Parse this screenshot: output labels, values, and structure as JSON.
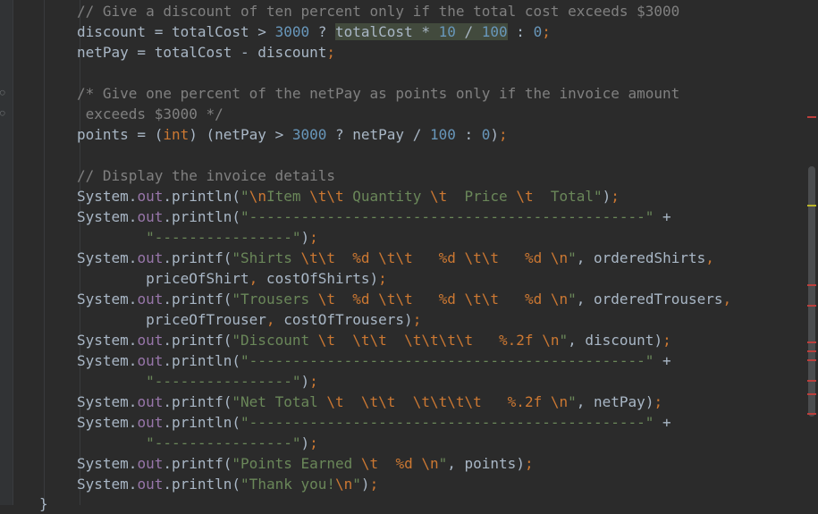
{
  "editor": {
    "lines": [
      [
        {
          "t": "// Give a discount of ten percent only if the total cost exceeds $3000",
          "c": "cmt"
        }
      ],
      [
        {
          "t": "discount = totalCost > ",
          "c": ""
        },
        {
          "t": "3000",
          "c": "num"
        },
        {
          "t": " ? ",
          "c": ""
        },
        {
          "t": "totalCost * ",
          "c": "hl"
        },
        {
          "t": "10",
          "c": "num hl"
        },
        {
          "t": " / ",
          "c": "hl"
        },
        {
          "t": "100",
          "c": "num hl"
        },
        {
          "t": " : ",
          "c": ""
        },
        {
          "t": "0",
          "c": "num"
        },
        {
          "t": ";",
          "c": "kw"
        }
      ],
      [
        {
          "t": "netPay = totalCost - discount",
          "c": ""
        },
        {
          "t": ";",
          "c": "kw"
        }
      ],
      [],
      [
        {
          "t": "/* Give one percent of the netPay as points only if the invoice amount",
          "c": "cmt"
        }
      ],
      [
        {
          "t": " exceeds $3000 */",
          "c": "cmt"
        }
      ],
      [
        {
          "t": "points = (",
          "c": ""
        },
        {
          "t": "int",
          "c": "kw"
        },
        {
          "t": ") (netPay > ",
          "c": ""
        },
        {
          "t": "3000",
          "c": "num"
        },
        {
          "t": " ? netPay / ",
          "c": ""
        },
        {
          "t": "100",
          "c": "num"
        },
        {
          "t": " : ",
          "c": ""
        },
        {
          "t": "0",
          "c": "num"
        },
        {
          "t": ")",
          "c": ""
        },
        {
          "t": ";",
          "c": "kw"
        }
      ],
      [],
      [
        {
          "t": "// Display the invoice details",
          "c": "cmt"
        }
      ],
      [
        {
          "t": "System.",
          "c": ""
        },
        {
          "t": "out",
          "c": "field"
        },
        {
          "t": ".println(",
          "c": ""
        },
        {
          "t": "\"",
          "c": "str"
        },
        {
          "t": "\\n",
          "c": "esc"
        },
        {
          "t": "Item ",
          "c": "str"
        },
        {
          "t": "\\t\\t",
          "c": "esc"
        },
        {
          "t": " Quantity ",
          "c": "str"
        },
        {
          "t": "\\t",
          "c": "esc"
        },
        {
          "t": "  Price ",
          "c": "str"
        },
        {
          "t": "\\t",
          "c": "esc"
        },
        {
          "t": "  Total\"",
          "c": "str"
        },
        {
          "t": ")",
          "c": ""
        },
        {
          "t": ";",
          "c": "kw"
        }
      ],
      [
        {
          "t": "System.",
          "c": ""
        },
        {
          "t": "out",
          "c": "field"
        },
        {
          "t": ".println(",
          "c": ""
        },
        {
          "t": "\"----------------------------------------------\"",
          "c": "str"
        },
        {
          "t": " +",
          "c": ""
        }
      ],
      [
        {
          "t": "        ",
          "c": ""
        },
        {
          "t": "\"----------------\"",
          "c": "str"
        },
        {
          "t": ")",
          "c": ""
        },
        {
          "t": ";",
          "c": "kw"
        }
      ],
      [
        {
          "t": "System.",
          "c": ""
        },
        {
          "t": "out",
          "c": "field"
        },
        {
          "t": ".printf(",
          "c": ""
        },
        {
          "t": "\"Shirts ",
          "c": "str"
        },
        {
          "t": "\\t\\t",
          "c": "esc"
        },
        {
          "t": "  ",
          "c": "str"
        },
        {
          "t": "%d",
          "c": "fmt"
        },
        {
          "t": " ",
          "c": "str"
        },
        {
          "t": "\\t\\t",
          "c": "esc"
        },
        {
          "t": "   ",
          "c": "str"
        },
        {
          "t": "%d",
          "c": "fmt"
        },
        {
          "t": " ",
          "c": "str"
        },
        {
          "t": "\\t\\t",
          "c": "esc"
        },
        {
          "t": "   ",
          "c": "str"
        },
        {
          "t": "%d",
          "c": "fmt"
        },
        {
          "t": " ",
          "c": "str"
        },
        {
          "t": "\\n",
          "c": "esc"
        },
        {
          "t": "\"",
          "c": "str"
        },
        {
          "t": ", orderedShirts",
          "c": ""
        },
        {
          "t": ",",
          "c": "kw"
        }
      ],
      [
        {
          "t": "        priceOfShirt",
          "c": ""
        },
        {
          "t": ",",
          "c": "kw"
        },
        {
          "t": " costOfShirts)",
          "c": ""
        },
        {
          "t": ";",
          "c": "kw"
        }
      ],
      [
        {
          "t": "System.",
          "c": ""
        },
        {
          "t": "out",
          "c": "field"
        },
        {
          "t": ".printf(",
          "c": ""
        },
        {
          "t": "\"Trousers ",
          "c": "str"
        },
        {
          "t": "\\t",
          "c": "esc"
        },
        {
          "t": "  ",
          "c": "str"
        },
        {
          "t": "%d",
          "c": "fmt"
        },
        {
          "t": " ",
          "c": "str"
        },
        {
          "t": "\\t\\t",
          "c": "esc"
        },
        {
          "t": "   ",
          "c": "str"
        },
        {
          "t": "%d",
          "c": "fmt"
        },
        {
          "t": " ",
          "c": "str"
        },
        {
          "t": "\\t\\t",
          "c": "esc"
        },
        {
          "t": "   ",
          "c": "str"
        },
        {
          "t": "%d",
          "c": "fmt"
        },
        {
          "t": " ",
          "c": "str"
        },
        {
          "t": "\\n",
          "c": "esc"
        },
        {
          "t": "\"",
          "c": "str"
        },
        {
          "t": ", orderedTrousers",
          "c": ""
        },
        {
          "t": ",",
          "c": "kw"
        }
      ],
      [
        {
          "t": "        priceOfTrouser",
          "c": ""
        },
        {
          "t": ",",
          "c": "kw"
        },
        {
          "t": " costOfTrousers)",
          "c": ""
        },
        {
          "t": ";",
          "c": "kw"
        }
      ],
      [
        {
          "t": "System.",
          "c": ""
        },
        {
          "t": "out",
          "c": "field"
        },
        {
          "t": ".printf(",
          "c": ""
        },
        {
          "t": "\"Discount ",
          "c": "str"
        },
        {
          "t": "\\t",
          "c": "esc"
        },
        {
          "t": "  ",
          "c": "str"
        },
        {
          "t": "\\t\\t",
          "c": "esc"
        },
        {
          "t": "  ",
          "c": "str"
        },
        {
          "t": "\\t\\t\\t\\t",
          "c": "esc"
        },
        {
          "t": "   ",
          "c": "str"
        },
        {
          "t": "%.2f",
          "c": "fmt"
        },
        {
          "t": " ",
          "c": "str"
        },
        {
          "t": "\\n",
          "c": "esc"
        },
        {
          "t": "\"",
          "c": "str"
        },
        {
          "t": ", discount)",
          "c": ""
        },
        {
          "t": ";",
          "c": "kw"
        }
      ],
      [
        {
          "t": "System.",
          "c": ""
        },
        {
          "t": "out",
          "c": "field"
        },
        {
          "t": ".println(",
          "c": ""
        },
        {
          "t": "\"----------------------------------------------\"",
          "c": "str"
        },
        {
          "t": " +",
          "c": ""
        }
      ],
      [
        {
          "t": "        ",
          "c": ""
        },
        {
          "t": "\"----------------\"",
          "c": "str"
        },
        {
          "t": ")",
          "c": ""
        },
        {
          "t": ";",
          "c": "kw"
        }
      ],
      [
        {
          "t": "System.",
          "c": ""
        },
        {
          "t": "out",
          "c": "field"
        },
        {
          "t": ".printf(",
          "c": ""
        },
        {
          "t": "\"Net Total ",
          "c": "str"
        },
        {
          "t": "\\t",
          "c": "esc"
        },
        {
          "t": "  ",
          "c": "str"
        },
        {
          "t": "\\t\\t",
          "c": "esc"
        },
        {
          "t": "  ",
          "c": "str"
        },
        {
          "t": "\\t\\t\\t\\t",
          "c": "esc"
        },
        {
          "t": "   ",
          "c": "str"
        },
        {
          "t": "%.2f",
          "c": "fmt"
        },
        {
          "t": " ",
          "c": "str"
        },
        {
          "t": "\\n",
          "c": "esc"
        },
        {
          "t": "\"",
          "c": "str"
        },
        {
          "t": ", netPay)",
          "c": ""
        },
        {
          "t": ";",
          "c": "kw"
        }
      ],
      [
        {
          "t": "System.",
          "c": ""
        },
        {
          "t": "out",
          "c": "field"
        },
        {
          "t": ".println(",
          "c": ""
        },
        {
          "t": "\"----------------------------------------------\"",
          "c": "str"
        },
        {
          "t": " +",
          "c": ""
        }
      ],
      [
        {
          "t": "        ",
          "c": ""
        },
        {
          "t": "\"----------------\"",
          "c": "str"
        },
        {
          "t": ")",
          "c": ""
        },
        {
          "t": ";",
          "c": "kw"
        }
      ],
      [
        {
          "t": "System.",
          "c": ""
        },
        {
          "t": "out",
          "c": "field"
        },
        {
          "t": ".printf(",
          "c": ""
        },
        {
          "t": "\"Points Earned ",
          "c": "str"
        },
        {
          "t": "\\t",
          "c": "esc"
        },
        {
          "t": "  ",
          "c": "str"
        },
        {
          "t": "%d",
          "c": "fmt"
        },
        {
          "t": " ",
          "c": "str"
        },
        {
          "t": "\\n",
          "c": "esc"
        },
        {
          "t": "\"",
          "c": "str"
        },
        {
          "t": ", points)",
          "c": ""
        },
        {
          "t": ";",
          "c": "kw"
        }
      ],
      [
        {
          "t": "System.",
          "c": ""
        },
        {
          "t": "out",
          "c": "field"
        },
        {
          "t": ".println(",
          "c": ""
        },
        {
          "t": "\"Thank you!",
          "c": "str"
        },
        {
          "t": "\\n",
          "c": "esc"
        },
        {
          "t": "\"",
          "c": "str"
        },
        {
          "t": ")",
          "c": ""
        },
        {
          "t": ";",
          "c": "kw"
        }
      ]
    ],
    "closing_brace": "}"
  },
  "colors": {
    "background": "#2b2b2b",
    "text": "#a9b7c6",
    "comment": "#808080",
    "number": "#6897bb",
    "keyword": "#cc7832",
    "string": "#6a8759",
    "field": "#9876aa"
  }
}
